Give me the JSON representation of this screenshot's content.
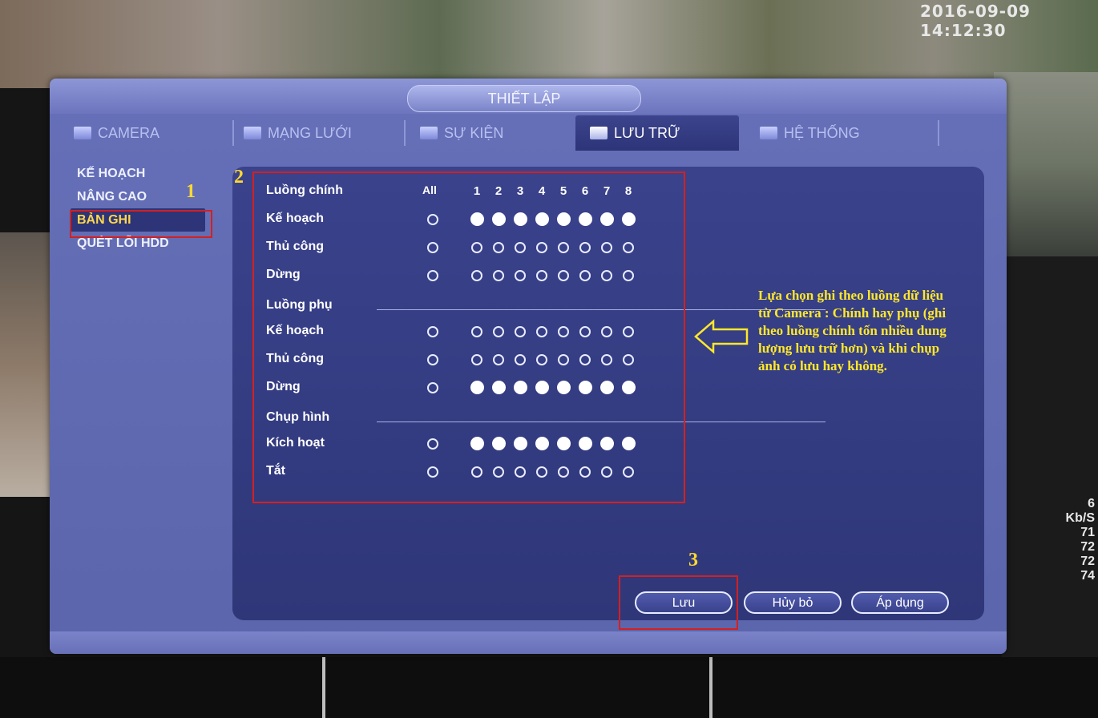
{
  "overlay": {
    "timestamp": "2016-09-09 14:12:30",
    "stats": [
      "6",
      "Kb/S",
      "71",
      "72",
      "72",
      "74"
    ]
  },
  "dialog": {
    "title": "THIẾT LẬP",
    "tabs": [
      {
        "label": "CAMERA",
        "icon": "camera-icon",
        "active": false
      },
      {
        "label": "MẠNG LƯỚI",
        "icon": "network-icon",
        "active": false
      },
      {
        "label": "SỰ KIỆN",
        "icon": "event-icon",
        "active": false
      },
      {
        "label": "LƯU TRỮ",
        "icon": "storage-icon",
        "active": true
      },
      {
        "label": "HỆ THỐNG",
        "icon": "system-icon",
        "active": false
      }
    ],
    "side_menu": [
      {
        "label": "KẾ HOẠCH",
        "active": false
      },
      {
        "label": "NÂNG CAO",
        "active": false
      },
      {
        "label": "BẢN GHI",
        "active": true
      },
      {
        "label": "QUÉT LỖI HDD",
        "active": false
      }
    ],
    "record": {
      "header": {
        "label": "Luồng chính",
        "all": "All",
        "channels": [
          "1",
          "2",
          "3",
          "4",
          "5",
          "6",
          "7",
          "8"
        ]
      },
      "main_stream": [
        {
          "label": "Kế hoạch",
          "all": false,
          "channels": [
            true,
            true,
            true,
            true,
            true,
            true,
            true,
            true
          ]
        },
        {
          "label": "Thủ công",
          "all": false,
          "channels": [
            false,
            false,
            false,
            false,
            false,
            false,
            false,
            false
          ]
        },
        {
          "label": "Dừng",
          "all": false,
          "channels": [
            false,
            false,
            false,
            false,
            false,
            false,
            false,
            false
          ]
        }
      ],
      "sub_stream_label": "Luồng phụ",
      "sub_stream": [
        {
          "label": "Kế hoạch",
          "all": false,
          "channels": [
            false,
            false,
            false,
            false,
            false,
            false,
            false,
            false
          ]
        },
        {
          "label": "Thủ công",
          "all": false,
          "channels": [
            false,
            false,
            false,
            false,
            false,
            false,
            false,
            false
          ]
        },
        {
          "label": "Dừng",
          "all": false,
          "channels": [
            true,
            true,
            true,
            true,
            true,
            true,
            true,
            true
          ]
        }
      ],
      "snapshot_label": "Chụp hình",
      "snapshot": [
        {
          "label": "Kích hoạt",
          "all": false,
          "channels": [
            true,
            true,
            true,
            true,
            true,
            true,
            true,
            true
          ]
        },
        {
          "label": "Tắt",
          "all": false,
          "channels": [
            false,
            false,
            false,
            false,
            false,
            false,
            false,
            false
          ]
        }
      ]
    },
    "buttons": {
      "save": "Lưu",
      "cancel": "Hủy bỏ",
      "apply": "Áp dụng"
    }
  },
  "annotations": {
    "num1": "1",
    "num2": "2",
    "num3": "3",
    "note": "Lựa chọn ghi theo luồng dữ liệu từ Camera : Chính hay phụ (ghi theo luồng chính tốn nhiều dung lượng lưu trữ hơn) và khi chụp ảnh có lưu hay không.",
    "annotation_color": "#ffe82a",
    "box_color": "#d42020"
  }
}
